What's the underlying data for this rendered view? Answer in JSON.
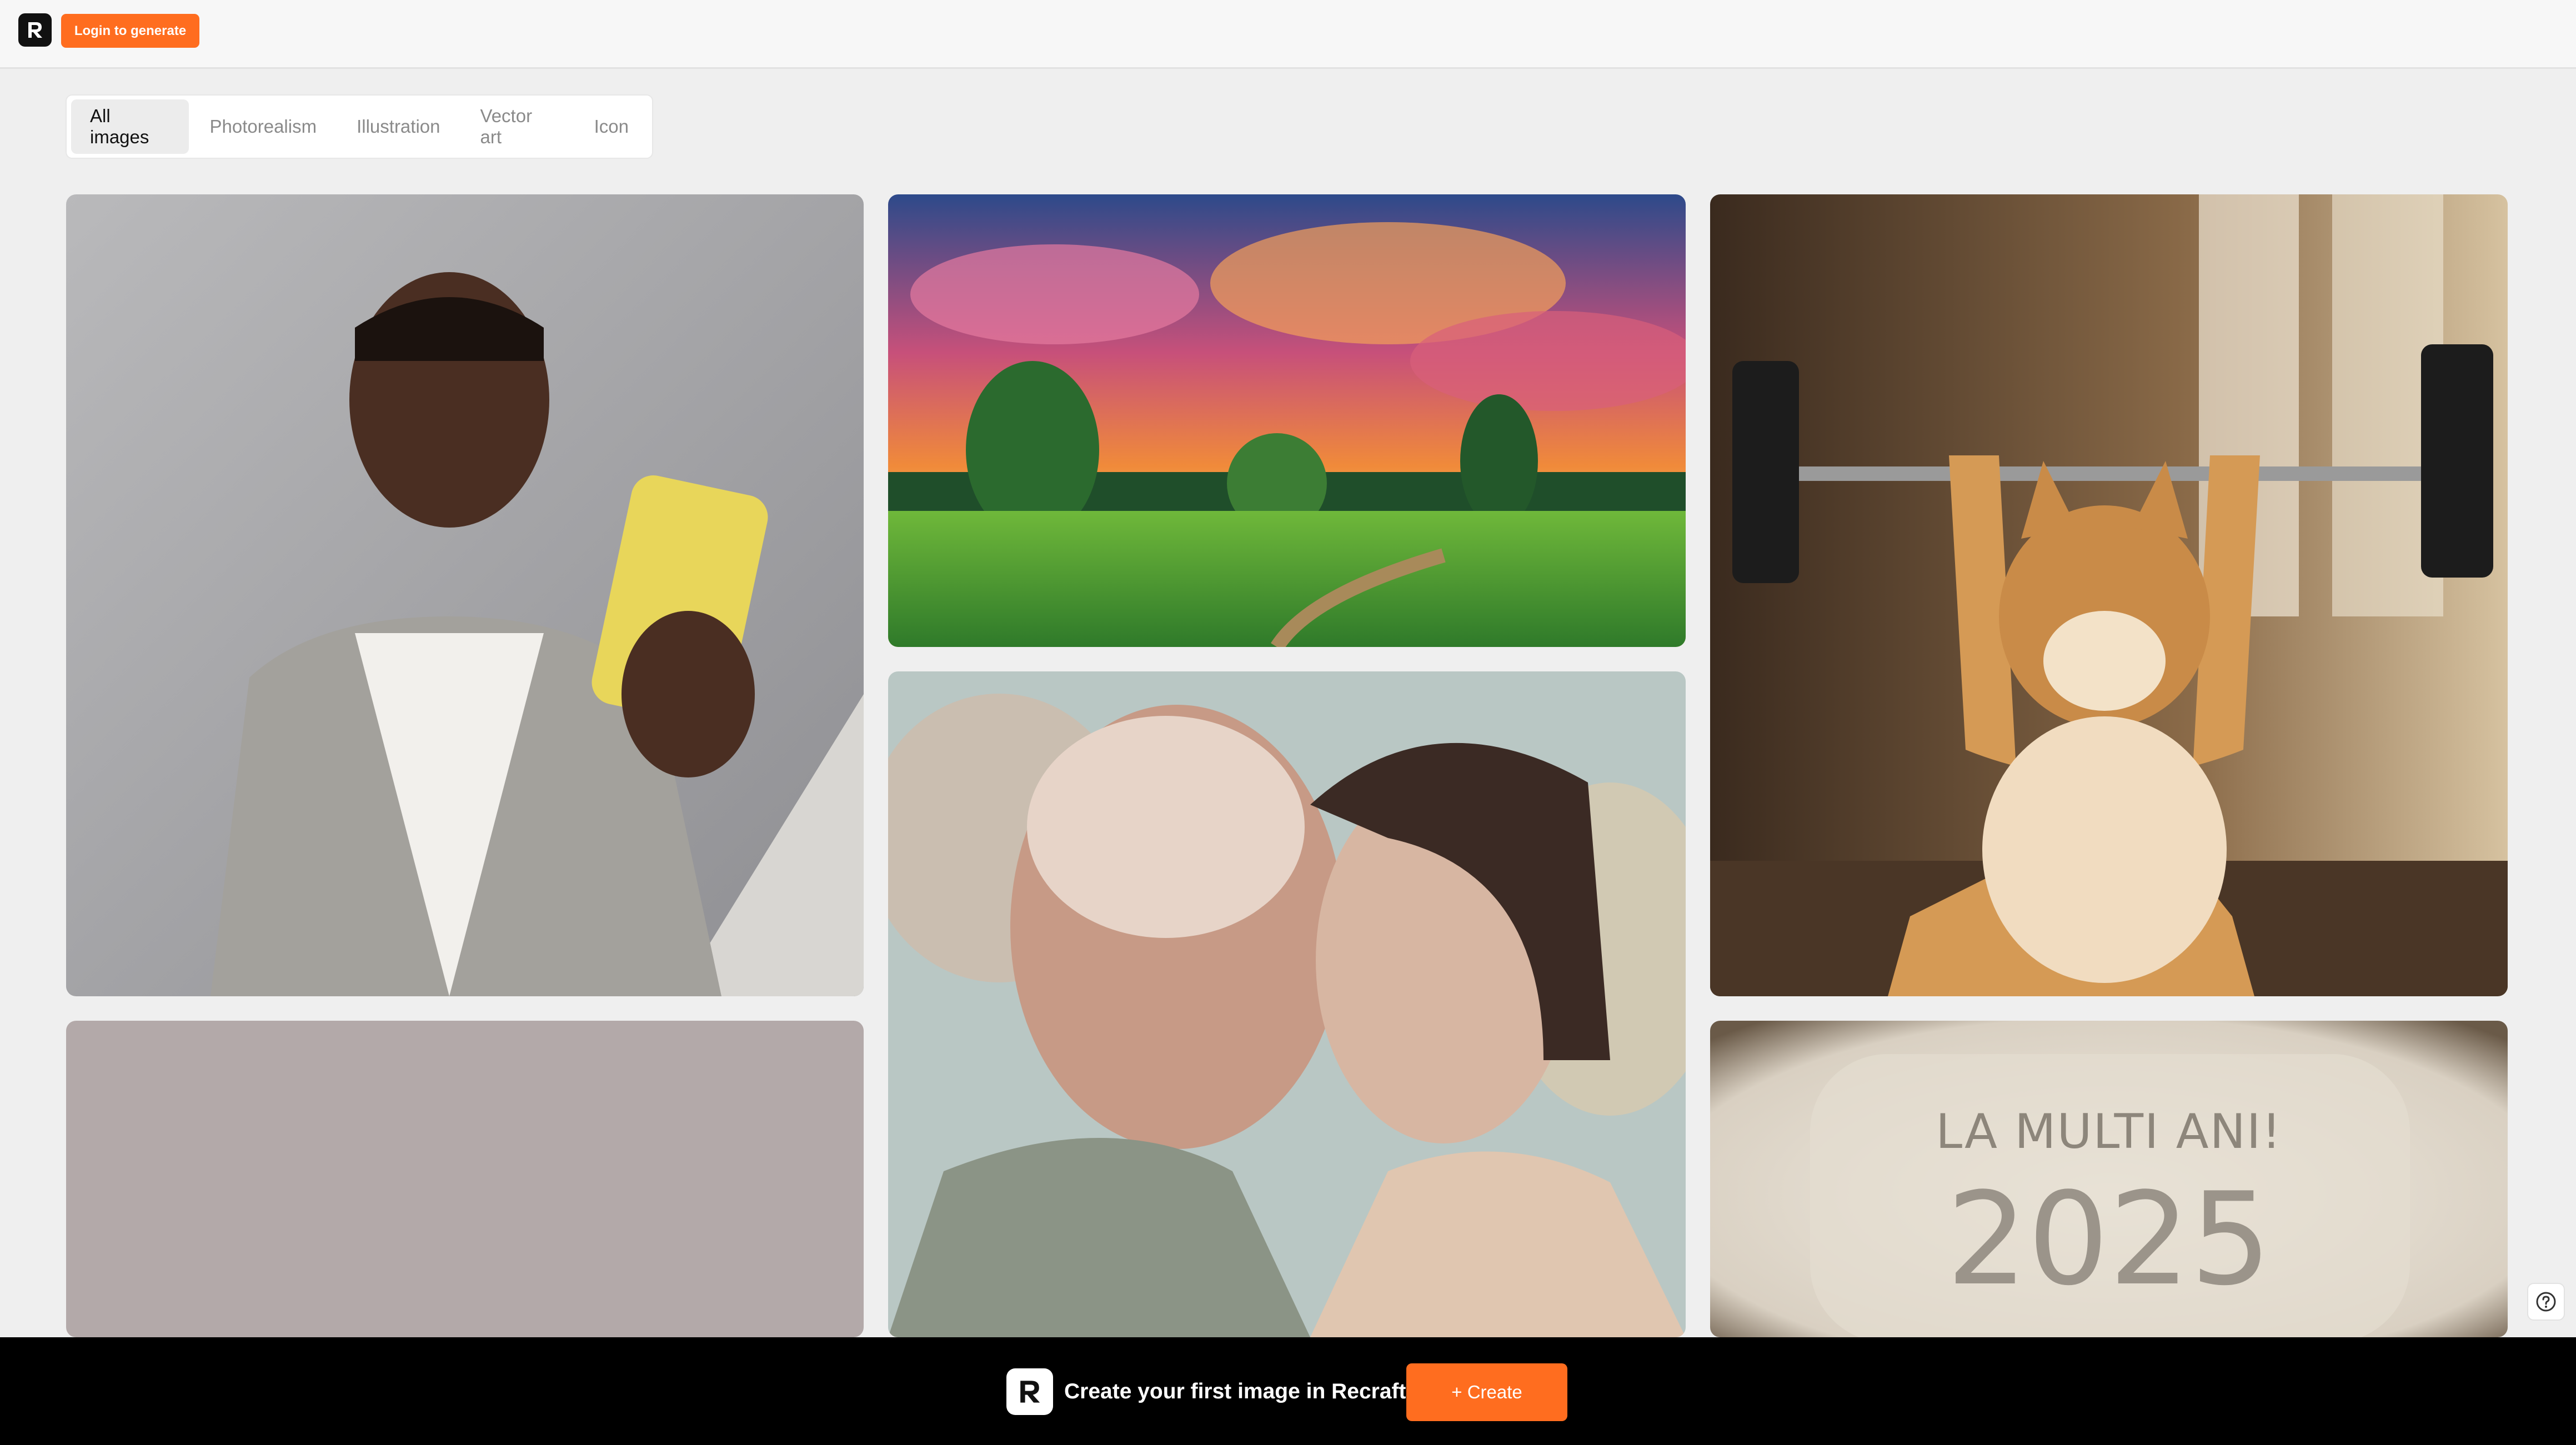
{
  "header": {
    "logo_icon": "recraft-logo-icon",
    "login_button": "Login to generate",
    "accent_color": "#ff6d1f"
  },
  "tabs": [
    {
      "label": "All images",
      "active": true
    },
    {
      "label": "Photorealism",
      "active": false
    },
    {
      "label": "Illustration",
      "active": false
    },
    {
      "label": "Vector art",
      "active": false
    },
    {
      "label": "Icon",
      "active": false
    }
  ],
  "gallery": {
    "flour_card": {
      "line1": "LA MULTI ANI!",
      "line2": "2025"
    }
  },
  "help_icon": "question-circle-icon",
  "promo_bar": {
    "text": "Create your first image in Recraft",
    "create_button": "+ Create"
  }
}
